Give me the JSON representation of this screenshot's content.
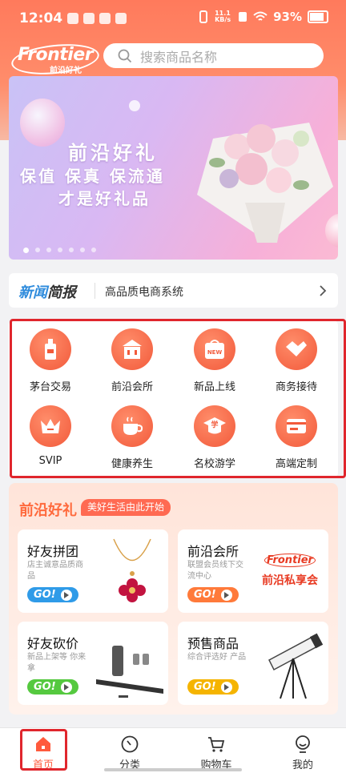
{
  "status_bar": {
    "time": "12:04",
    "network": "11.1 KB/s",
    "battery": "93%"
  },
  "header": {
    "logo_text": "Frontier",
    "logo_sub": "前沿好礼",
    "search_placeholder": "搜索商品名称"
  },
  "banner": {
    "line1": "前沿好礼",
    "line2": "保值 保真 保流通",
    "line3": "才是好礼品",
    "slide_count": 7
  },
  "news": {
    "tag_a": "新闻",
    "tag_b": "简报",
    "text": "高品质电商系统"
  },
  "categories": [
    {
      "label": "茅台交易",
      "icon": "bottle-icon"
    },
    {
      "label": "前沿会所",
      "icon": "building-icon"
    },
    {
      "label": "新品上线",
      "icon": "new-bag-icon"
    },
    {
      "label": "商务接待",
      "icon": "handshake-icon"
    },
    {
      "label": "SVIP",
      "icon": "crown-icon"
    },
    {
      "label": "健康养生",
      "icon": "tea-cup-icon"
    },
    {
      "label": "名校游学",
      "icon": "graduation-cap-icon"
    },
    {
      "label": "高端定制",
      "icon": "card-icon"
    }
  ],
  "promo": {
    "title": "前沿好礼",
    "subtitle": "美好生活由此开始",
    "go_label": "GO!",
    "cards": [
      {
        "title": "好友拼团",
        "desc": "店主诚意品质商品",
        "go_color": "#2f9be8"
      },
      {
        "title": "前沿会所",
        "desc": "联盟会员线下交流中心",
        "go_color": "#ff7a3a",
        "brand_en": "Frontier",
        "brand_cn": "前沿私享会"
      },
      {
        "title": "好友砍价",
        "desc": "新品上架等 你来拿",
        "go_color": "#55c93f"
      },
      {
        "title": "预售商品",
        "desc": "综合评选好 产品",
        "go_color": "#f5b400"
      }
    ]
  },
  "tabbar": [
    {
      "label": "首页",
      "active": true
    },
    {
      "label": "分类"
    },
    {
      "label": "购物车"
    },
    {
      "label": "我的"
    }
  ],
  "colors": {
    "accent": "#ff6a3d",
    "active_tab": "#ff5a3c",
    "highlight_box": "#e0262d"
  }
}
